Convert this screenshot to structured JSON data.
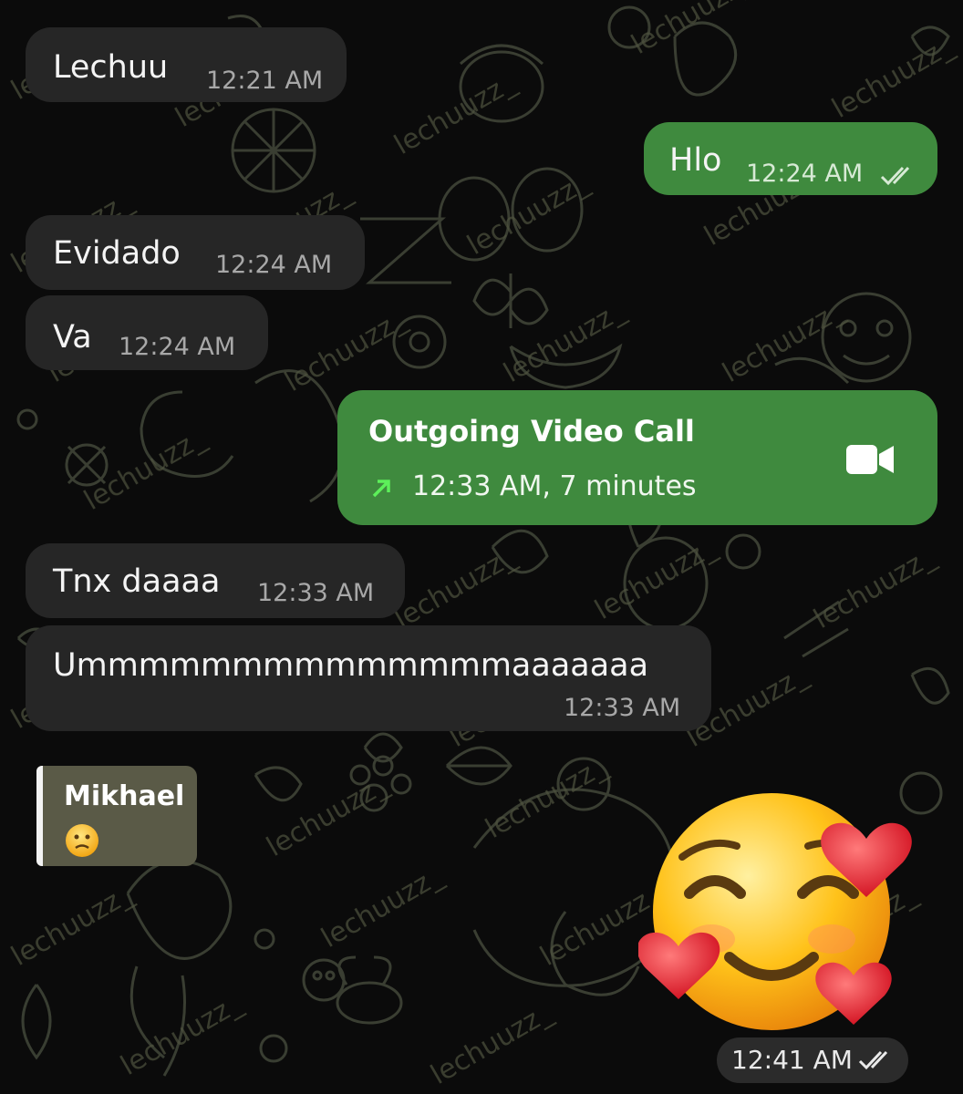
{
  "messages": [
    {
      "id": "m1",
      "direction": "incoming",
      "text": "Lechuu",
      "time": "12:21 AM"
    },
    {
      "id": "m2",
      "direction": "outgoing",
      "text": "Hlo",
      "time": "12:24 AM",
      "status": "read"
    },
    {
      "id": "m3",
      "direction": "incoming",
      "text": "Evidado",
      "time": "12:24 AM"
    },
    {
      "id": "m4",
      "direction": "incoming",
      "text": "Va",
      "time": "12:24 AM"
    },
    {
      "id": "m5",
      "direction": "outgoing",
      "type": "video-call",
      "title": "Outgoing Video Call",
      "detail": "12:33 AM, 7 minutes",
      "icon": "video-camera-icon"
    },
    {
      "id": "m6",
      "direction": "incoming",
      "text": "Tnx daaaa",
      "time": "12:33 AM"
    },
    {
      "id": "m7",
      "direction": "incoming",
      "text": "Ummmmmmmmmmmmmmaaaaaaa",
      "time": "12:33 AM"
    }
  ],
  "reply": {
    "name": "Mikhael",
    "emoji": "confused-face-icon"
  },
  "sticker": {
    "icon": "smiling-face-with-hearts-icon",
    "time": "12:41 AM",
    "status": "read"
  },
  "colors": {
    "incoming_bubble": "#262626",
    "outgoing_bubble": "#3f8a3e",
    "wallpaper": "#0b0b0b",
    "reply_card": "#5a5a47"
  }
}
